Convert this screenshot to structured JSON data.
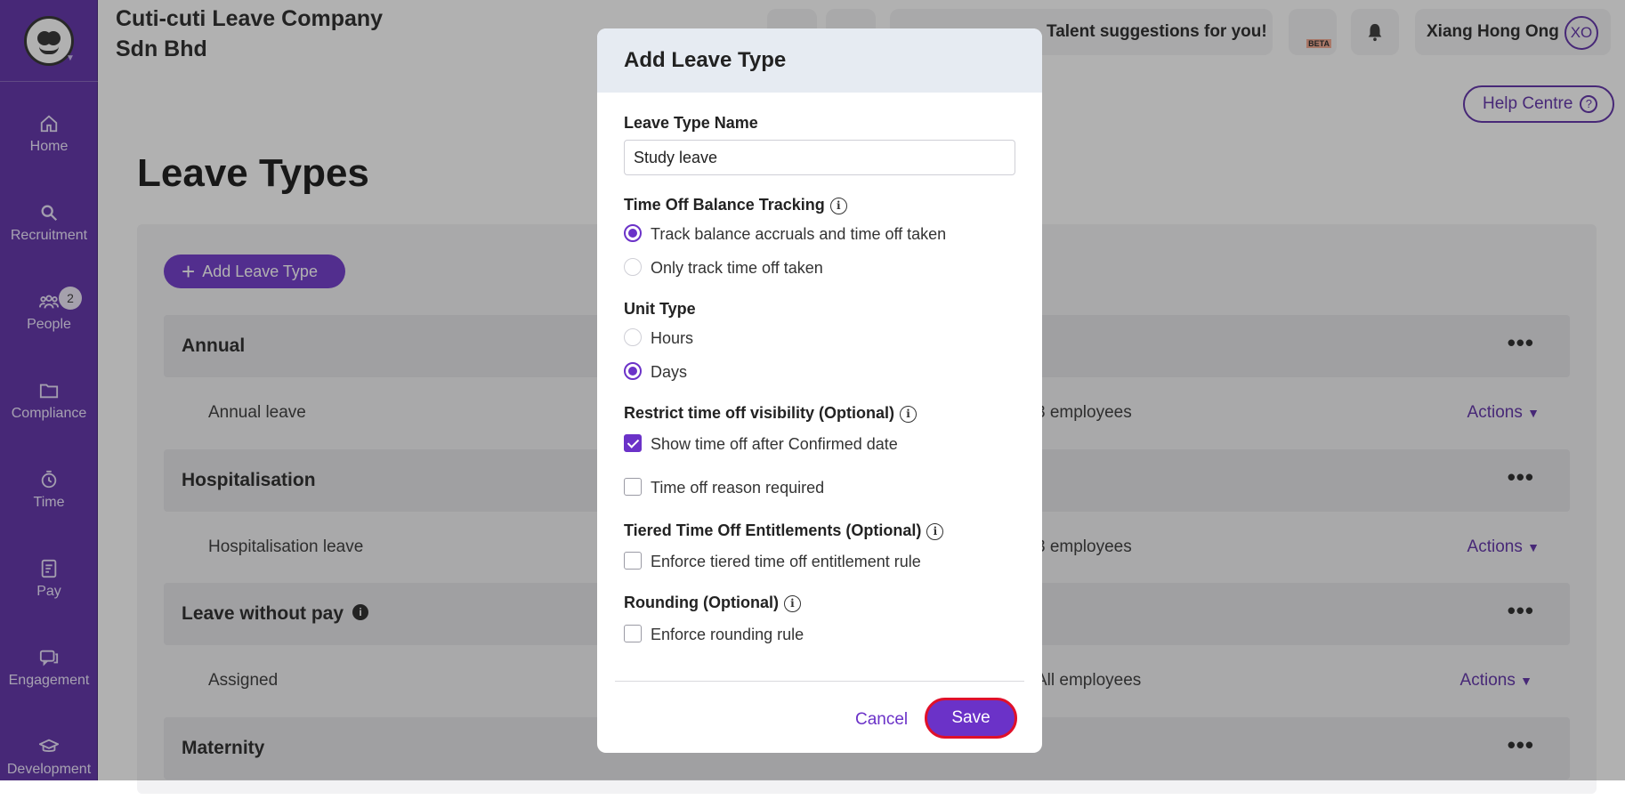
{
  "header": {
    "company_name": "Cuti-cuti Leave Company Sdn Bhd",
    "smartmatch_text": "Talent suggestions for you!",
    "beta_label": "BETA",
    "user_name": "Xiang Hong Ong",
    "user_initials": "XO",
    "help_label": "Help Centre"
  },
  "sidebar": {
    "items": [
      {
        "label": "Home",
        "icon": "home-icon"
      },
      {
        "label": "Recruitment",
        "icon": "search-icon"
      },
      {
        "label": "People",
        "icon": "people-icon",
        "badge": "2"
      },
      {
        "label": "Compliance",
        "icon": "folder-icon"
      },
      {
        "label": "Time",
        "icon": "clock-icon"
      },
      {
        "label": "Pay",
        "icon": "pay-icon"
      },
      {
        "label": "Engagement",
        "icon": "chat-icon"
      },
      {
        "label": "Development",
        "icon": "graduation-icon"
      }
    ]
  },
  "main": {
    "title": "Leave Types",
    "add_button": "Add Leave Type",
    "groups": [
      {
        "label": "Annual",
        "row_name": "Annual leave",
        "row_employees": "3 employees",
        "row_action": "Actions"
      },
      {
        "label": "Hospitalisation",
        "row_name": "Hospitalisation leave",
        "row_employees": "3 employees",
        "row_action": "Actions"
      },
      {
        "label": "Leave without pay",
        "row_name": "Assigned",
        "row_employees": "All employees",
        "row_action": "Actions"
      },
      {
        "label": "Maternity"
      }
    ]
  },
  "modal": {
    "title": "Add Leave Type",
    "name_label": "Leave Type Name",
    "name_value": "Study leave",
    "tracking_label": "Time Off Balance Tracking",
    "tracking_options": [
      "Track balance accruals and time off taken",
      "Only track time off taken"
    ],
    "tracking_selected": 0,
    "unit_label": "Unit Type",
    "unit_options": [
      "Hours",
      "Days"
    ],
    "unit_selected": 1,
    "visibility_label": "Restrict time off visibility (Optional)",
    "visibility_options": [
      {
        "label": "Show time off after Confirmed date",
        "checked": true
      },
      {
        "label": "Time off reason required",
        "checked": false
      }
    ],
    "tiered_label": "Tiered Time Off Entitlements (Optional)",
    "tiered_option": {
      "label": "Enforce tiered time off entitlement rule",
      "checked": false
    },
    "rounding_label": "Rounding (Optional)",
    "rounding_option": {
      "label": "Enforce rounding rule",
      "checked": false
    },
    "cancel_label": "Cancel",
    "save_label": "Save"
  },
  "colors": {
    "brand": "#5a2aa5",
    "accent": "#6b32c8",
    "highlight": "#e0102a"
  }
}
